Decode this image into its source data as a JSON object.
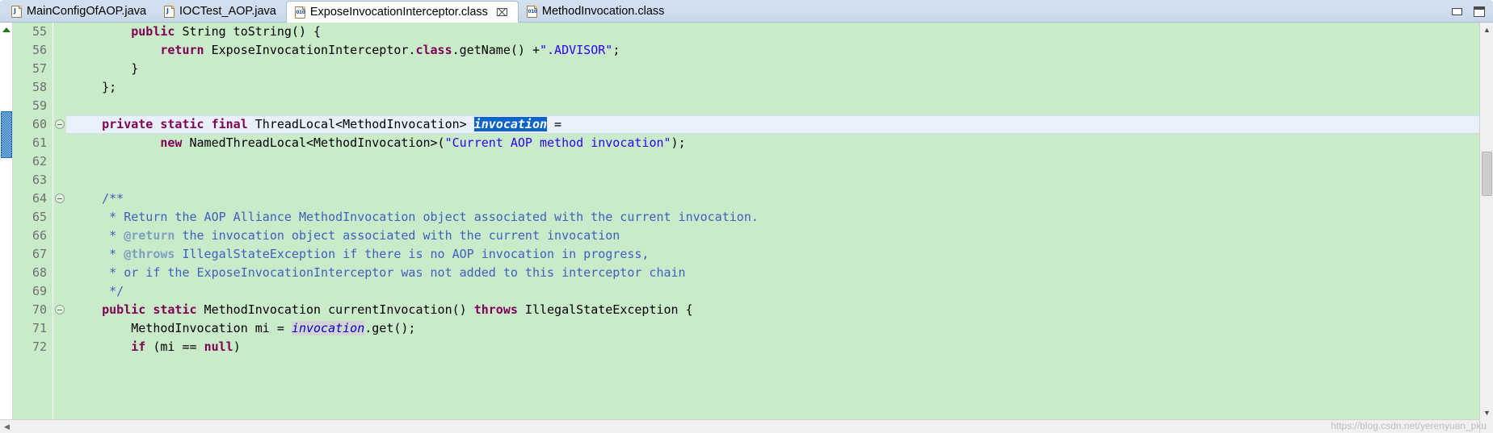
{
  "window": {
    "minimize_label": "Minimize",
    "maximize_label": "Maximize"
  },
  "tabs": [
    {
      "label": "MainConfigOfAOP.java",
      "icon": "java-file-icon",
      "active": false,
      "closable": false
    },
    {
      "label": "IOCTest_AOP.java",
      "icon": "java-file-icon",
      "active": false,
      "closable": false
    },
    {
      "label": "ExposeInvocationInterceptor.class",
      "icon": "class-file-icon",
      "active": true,
      "closable": true,
      "close_label": "⌧"
    },
    {
      "label": "MethodInvocation.class",
      "icon": "class-file-icon",
      "active": false,
      "closable": false
    }
  ],
  "editor": {
    "first_line": 55,
    "current_line": 60,
    "selected_text": "invocation",
    "occurrence_text": "invocation",
    "line_numbers": [
      55,
      56,
      57,
      58,
      59,
      60,
      61,
      62,
      63,
      64,
      65,
      66,
      67,
      68,
      69,
      70,
      71,
      72
    ],
    "lines": [
      {
        "n": 55,
        "segments": [
          {
            "t": "        ",
            "c": ""
          },
          {
            "t": "public",
            "c": "kw"
          },
          {
            "t": " String toString() {",
            "c": ""
          }
        ]
      },
      {
        "n": 56,
        "segments": [
          {
            "t": "            ",
            "c": ""
          },
          {
            "t": "return",
            "c": "kw"
          },
          {
            "t": " ExposeInvocationInterceptor.",
            "c": ""
          },
          {
            "t": "class",
            "c": "kw"
          },
          {
            "t": ".getName() +",
            "c": ""
          },
          {
            "t": "\".ADVISOR\"",
            "c": "str"
          },
          {
            "t": ";",
            "c": ""
          }
        ]
      },
      {
        "n": 57,
        "segments": [
          {
            "t": "        }",
            "c": ""
          }
        ]
      },
      {
        "n": 58,
        "segments": [
          {
            "t": "    };",
            "c": ""
          }
        ]
      },
      {
        "n": 59,
        "segments": [
          {
            "t": "",
            "c": ""
          }
        ]
      },
      {
        "n": 60,
        "segments": [
          {
            "t": "    ",
            "c": ""
          },
          {
            "t": "private static final",
            "c": "kw"
          },
          {
            "t": " ThreadLocal<MethodInvocation> ",
            "c": ""
          },
          {
            "t": "invocation",
            "c": "sel"
          },
          {
            "t": " =",
            "c": ""
          }
        ]
      },
      {
        "n": 61,
        "segments": [
          {
            "t": "            ",
            "c": ""
          },
          {
            "t": "new",
            "c": "kw"
          },
          {
            "t": " NamedThreadLocal<MethodInvocation>(",
            "c": ""
          },
          {
            "t": "\"Current AOP method invocation\"",
            "c": "str"
          },
          {
            "t": ");",
            "c": ""
          }
        ]
      },
      {
        "n": 62,
        "segments": [
          {
            "t": "",
            "c": ""
          }
        ]
      },
      {
        "n": 63,
        "segments": [
          {
            "t": "",
            "c": ""
          }
        ]
      },
      {
        "n": 64,
        "segments": [
          {
            "t": "    ",
            "c": ""
          },
          {
            "t": "/**",
            "c": "cmt"
          }
        ]
      },
      {
        "n": 65,
        "segments": [
          {
            "t": "     ",
            "c": ""
          },
          {
            "t": "* Return the AOP Alliance MethodInvocation object associated with the current invocation.",
            "c": "cmt"
          }
        ]
      },
      {
        "n": 66,
        "segments": [
          {
            "t": "     ",
            "c": ""
          },
          {
            "t": "* ",
            "c": "cmt"
          },
          {
            "t": "@return",
            "c": "tag"
          },
          {
            "t": " the invocation object associated with the current invocation",
            "c": "cmt"
          }
        ]
      },
      {
        "n": 67,
        "segments": [
          {
            "t": "     ",
            "c": ""
          },
          {
            "t": "* ",
            "c": "cmt"
          },
          {
            "t": "@throws",
            "c": "tag"
          },
          {
            "t": " IllegalStateException if there is no AOP invocation in progress,",
            "c": "cmt"
          }
        ]
      },
      {
        "n": 68,
        "segments": [
          {
            "t": "     ",
            "c": ""
          },
          {
            "t": "* or if the ExposeInvocationInterceptor was not added to this interceptor chain",
            "c": "cmt"
          }
        ]
      },
      {
        "n": 69,
        "segments": [
          {
            "t": "     ",
            "c": ""
          },
          {
            "t": "*/",
            "c": "cmt"
          }
        ]
      },
      {
        "n": 70,
        "segments": [
          {
            "t": "    ",
            "c": ""
          },
          {
            "t": "public static",
            "c": "kw"
          },
          {
            "t": " MethodInvocation currentInvocation() ",
            "c": ""
          },
          {
            "t": "throws",
            "c": "kw"
          },
          {
            "t": " IllegalStateException {",
            "c": ""
          }
        ]
      },
      {
        "n": 71,
        "segments": [
          {
            "t": "        MethodInvocation mi = ",
            "c": ""
          },
          {
            "t": "invocation",
            "c": "fld-hl"
          },
          {
            "t": ".get();",
            "c": ""
          }
        ]
      },
      {
        "n": 72,
        "segments": [
          {
            "t": "        ",
            "c": ""
          },
          {
            "t": "if",
            "c": "kw"
          },
          {
            "t": " (mi == ",
            "c": ""
          },
          {
            "t": "null",
            "c": "kw"
          },
          {
            "t": ")",
            "c": ""
          }
        ]
      }
    ],
    "folds": [
      {
        "line": 60
      },
      {
        "line": 64
      },
      {
        "line": 70
      }
    ],
    "scroll": {
      "up_arrow": "▲",
      "down_arrow": "▼",
      "left_arrow": "◀",
      "right_arrow": "▶"
    }
  },
  "watermark": "https://blog.csdn.net/yerenyuan_pku",
  "colors": {
    "code_background": "#c9ebca",
    "current_line": "#e8f0fb",
    "selection": "#0a64c8",
    "keyword": "#7f0055",
    "string": "#2a00ff",
    "comment": "#3f5fbf",
    "javadoc_tag": "#7f9fbf",
    "field": "#0000c0",
    "tabbar": "#cfdded",
    "line_number": "#707070"
  }
}
